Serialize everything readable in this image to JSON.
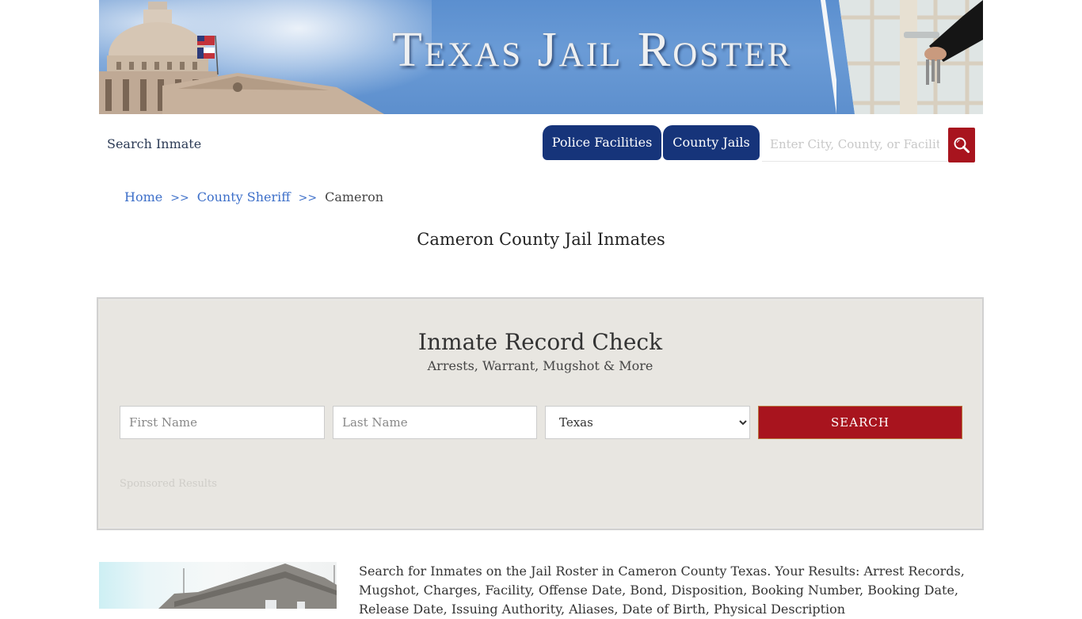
{
  "banner": {
    "title": "Texas Jail Roster"
  },
  "nav": {
    "search_inmate": "Search Inmate",
    "tabs": [
      {
        "label": "Police Facilities"
      },
      {
        "label": "County Jails"
      }
    ],
    "site_search": {
      "placeholder": "Enter City, County, or Facility",
      "value": ""
    },
    "search_icon": "magnifier-icon"
  },
  "breadcrumb": {
    "items": [
      {
        "label": "Home"
      },
      {
        "label": "County Sheriff"
      },
      {
        "label": "Cameron"
      }
    ],
    "separator": ">>"
  },
  "page": {
    "title": "Cameron County Jail Inmates"
  },
  "record_check": {
    "title": "Inmate Record Check",
    "subtitle": "Arrests, Warrant, Mugshot & More",
    "first_name": {
      "placeholder": "First Name",
      "value": ""
    },
    "last_name": {
      "placeholder": "Last Name",
      "value": ""
    },
    "state": {
      "selected": "Texas"
    },
    "search_label": "SEARCH",
    "sponsored": "Sponsored Results"
  },
  "content": {
    "description": "Search for Inmates on the Jail Roster in Cameron County Texas. Your Results: Arrest Records, Mugshot, Charges, Facility, Offense Date, Bond, Disposition, Booking Number, Booking Date, Release Date, Issuing Authority, Aliases, Date of Birth, Physical Description"
  },
  "colors": {
    "nav_blue": "#16347a",
    "accent_red": "#a8141e",
    "link_blue": "#3d6fc9",
    "box_bg": "#e8e6e1"
  }
}
